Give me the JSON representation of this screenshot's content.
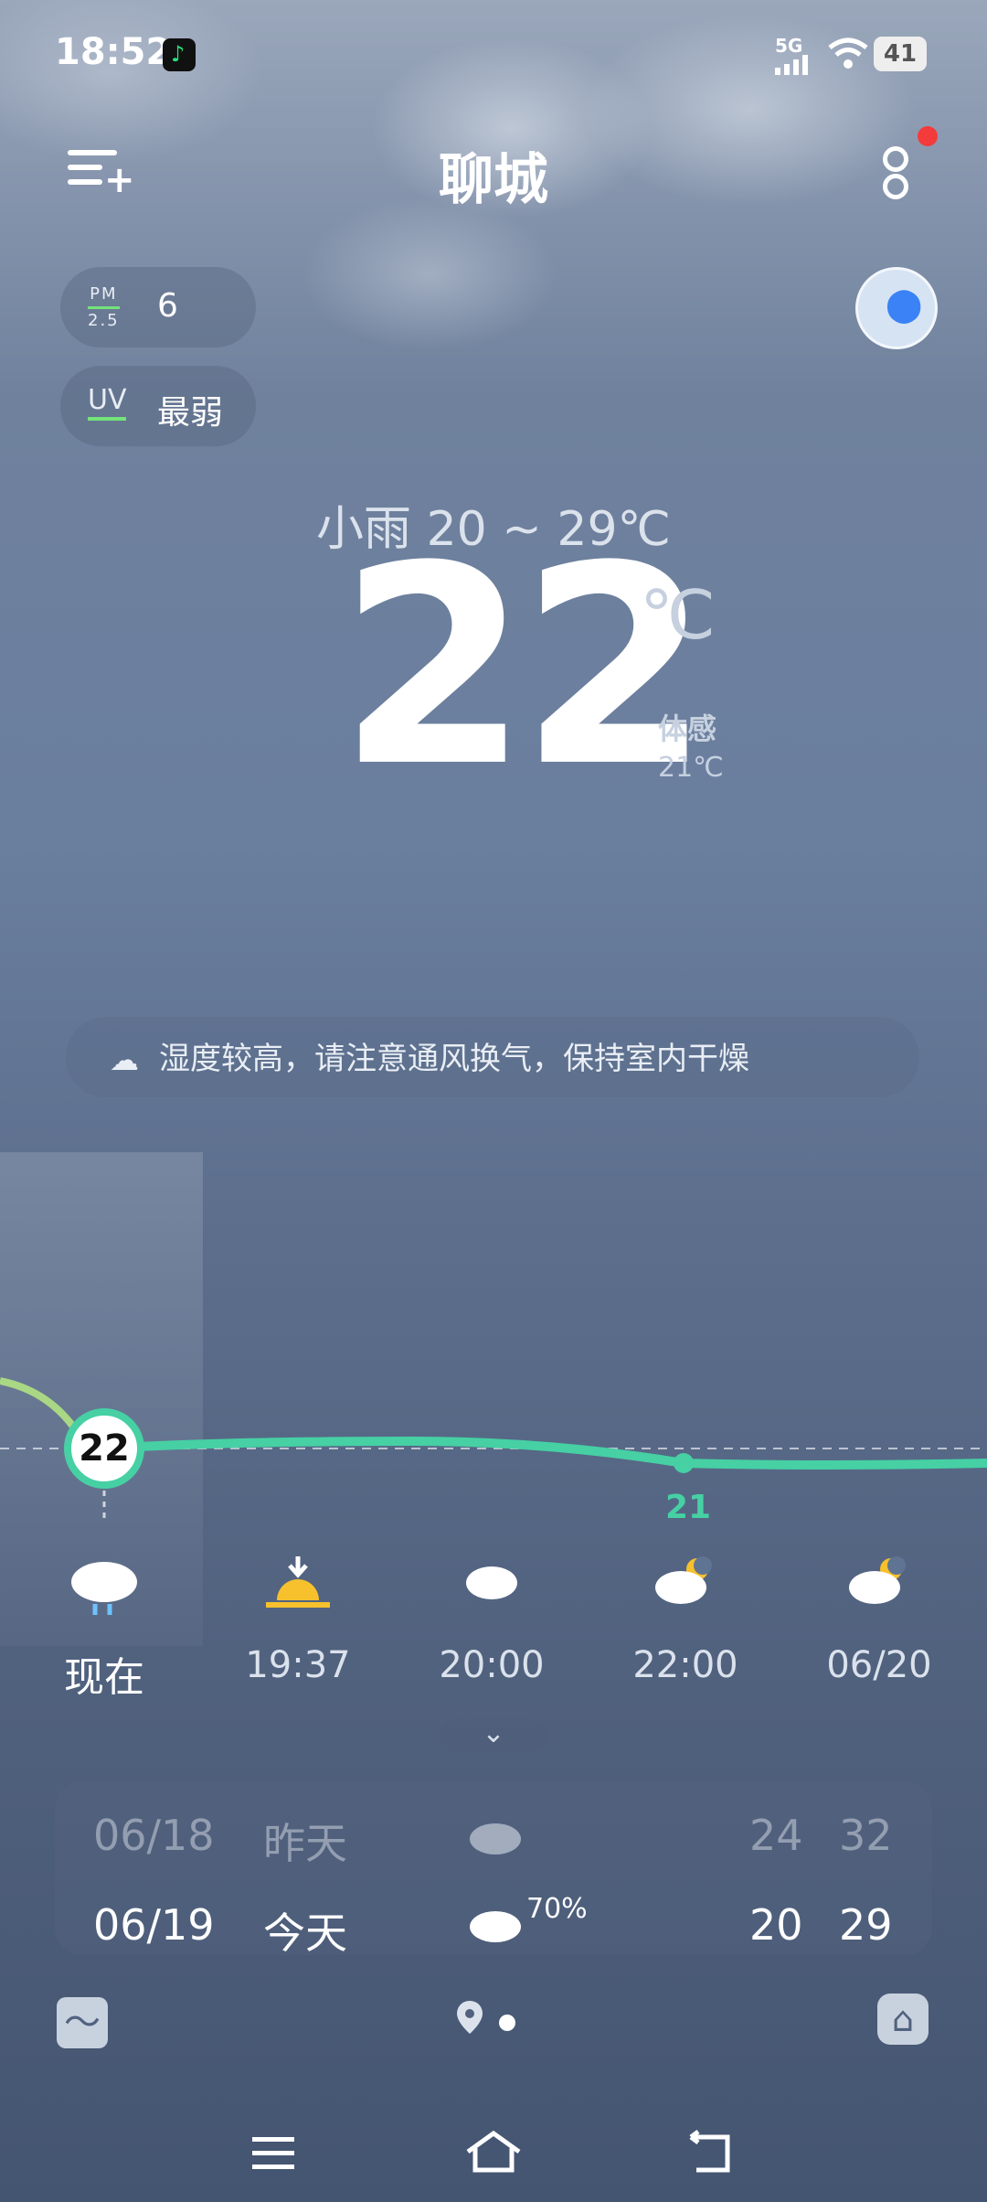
{
  "status_bar": {
    "time": "18:52",
    "network": "5G",
    "battery": "41"
  },
  "header": {
    "city": "聊城"
  },
  "air": {
    "pm_label_top": "PM",
    "pm_label_bottom": "2.5",
    "pm_value": "6",
    "uv_label": "UV",
    "uv_value": "最弱"
  },
  "current": {
    "summary": "小雨  20 ~ 29℃",
    "temperature": "22",
    "unit": "℃",
    "feels_like_label": "体感",
    "feels_like_value": "21℃"
  },
  "tip": {
    "text": "湿度较高，请注意通风换气，保持室内干燥"
  },
  "hourly": {
    "now_value": "22",
    "value_marker": "21",
    "items": [
      {
        "label": "现在",
        "icon": "rain-cloud-icon"
      },
      {
        "label": "19:37",
        "icon": "sunset-icon"
      },
      {
        "label": "20:00",
        "icon": "cloud-icon"
      },
      {
        "label": "22:00",
        "icon": "cloud-moon-icon"
      },
      {
        "label": "06/20",
        "icon": "cloud-moon-icon"
      }
    ]
  },
  "daily": [
    {
      "date": "06/18",
      "day": "昨天",
      "icon": "cloud-icon",
      "precip": "",
      "low": "24",
      "high": "32"
    },
    {
      "date": "06/19",
      "day": "今天",
      "icon": "cloud-icon",
      "precip": "70%",
      "low": "20",
      "high": "29"
    }
  ],
  "colors": {
    "accent": "#46d0a4",
    "pm_bar": "#74e37a",
    "notification": "#f43b3b"
  }
}
